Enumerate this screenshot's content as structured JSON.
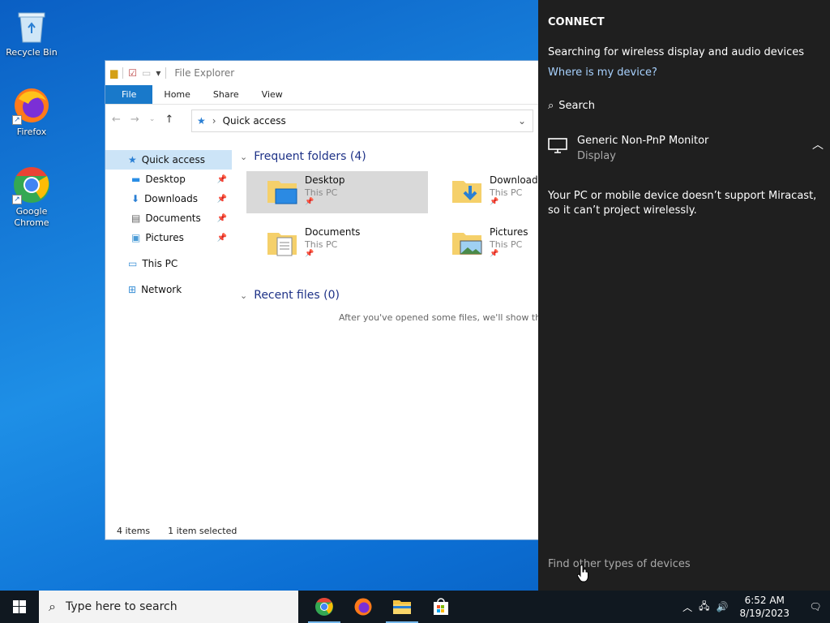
{
  "desktop": {
    "icons": [
      {
        "label": "Recycle Bin"
      },
      {
        "label": "Firefox"
      },
      {
        "label": "Google Chrome"
      }
    ]
  },
  "explorer": {
    "title": "File Explorer",
    "ribbon_tabs": [
      "File",
      "Home",
      "Share",
      "View"
    ],
    "address": "Quick access",
    "nav": {
      "quick_access": "Quick access",
      "pinned": [
        "Desktop",
        "Downloads",
        "Documents",
        "Pictures"
      ],
      "this_pc": "This PC",
      "network": "Network"
    },
    "frequent_header": "Frequent folders (4)",
    "folders": [
      {
        "name": "Desktop",
        "location": "This PC"
      },
      {
        "name": "Downloads",
        "location": "This PC"
      },
      {
        "name": "Documents",
        "location": "This PC"
      },
      {
        "name": "Pictures",
        "location": "This PC"
      }
    ],
    "recent_header": "Recent files (0)",
    "recent_empty": "After you've opened some files, we'll show the",
    "status_items": "4 items",
    "status_selected": "1 item selected"
  },
  "connect": {
    "title": "CONNECT",
    "searching": "Searching for wireless display and audio devices",
    "where_link": "Where is my device?",
    "search_label": "Search",
    "device_name": "Generic Non-PnP Monitor",
    "device_type": "Display",
    "warning": "Your PC or mobile device doesn’t support Miracast, so it can’t project wirelessly.",
    "find_other": "Find other types of devices"
  },
  "taskbar": {
    "search_placeholder": "Type here to search",
    "time": "6:52 AM",
    "date": "8/19/2023"
  }
}
